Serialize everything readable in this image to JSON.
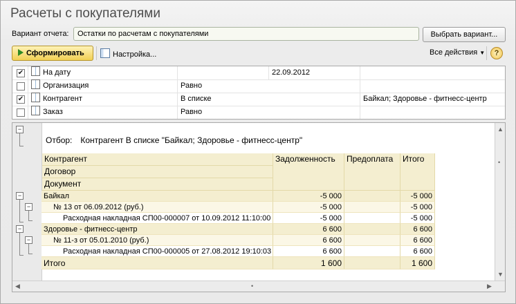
{
  "window": {
    "title": "Расчеты с покупателями"
  },
  "variant": {
    "label": "Вариант отчета:",
    "value": "Остатки по расчетам с покупателями",
    "choose_button": "Выбрать вариант..."
  },
  "toolbar": {
    "generate": "Сформировать",
    "settings": "Настройка...",
    "all_actions": "Все действия",
    "help": "?"
  },
  "filters": [
    {
      "checked": true,
      "mark": "✔",
      "name": "На дату",
      "condition": "",
      "value": "22.09.2012"
    },
    {
      "checked": false,
      "mark": "",
      "name": "Организация",
      "condition": "Равно",
      "value": ""
    },
    {
      "checked": true,
      "mark": "✔",
      "name": "Контрагент",
      "condition": "В списке",
      "value": "Байкал; Здоровье - фитнесс-центр"
    },
    {
      "checked": false,
      "mark": "",
      "name": "Заказ",
      "condition": "Равно",
      "value": ""
    }
  ],
  "report": {
    "filter_label": "Отбор:",
    "filter_text": "Контрагент В списке \"Байкал; Здоровье - фитнесс-центр\"",
    "headers": {
      "group1": "Контрагент",
      "group2": "Договор",
      "group3": "Документ",
      "debt": "Задолженность",
      "prepay": "Предоплата",
      "total": "Итого"
    },
    "rows": [
      {
        "level": 0,
        "name": "Байкал",
        "debt": "-5 000",
        "prepay": "",
        "total": "-5 000"
      },
      {
        "level": 1,
        "name": "№ 13 от 06.09.2012 (руб.)",
        "debt": "-5 000",
        "prepay": "",
        "total": "-5 000"
      },
      {
        "level": 2,
        "name": "Расходная накладная СП00-000007 от 10.09.2012 11:10:00",
        "debt": "-5 000",
        "prepay": "",
        "total": "-5 000"
      },
      {
        "level": 0,
        "name": "Здоровье - фитнесс-центр",
        "debt": "6 600",
        "prepay": "",
        "total": "6 600"
      },
      {
        "level": 1,
        "name": "№ 11-з от 05.01.2010 (руб.)",
        "debt": "6 600",
        "prepay": "",
        "total": "6 600"
      },
      {
        "level": 2,
        "name": "Расходная накладная СП00-000005 от 27.08.2012 19:10:03",
        "debt": "6 600",
        "prepay": "",
        "total": "6 600"
      }
    ],
    "grand_total": {
      "label": "Итого",
      "debt": "1 600",
      "prepay": "",
      "total": "1 600"
    }
  },
  "icons": {
    "play": "play-icon",
    "settings": "settings-grid-icon",
    "filter": "filter-field-icon",
    "help": "help-icon"
  },
  "colors": {
    "generate_button": "#f1cf54",
    "header_fill": "#f4eed0",
    "title": "#4d4d4d"
  }
}
